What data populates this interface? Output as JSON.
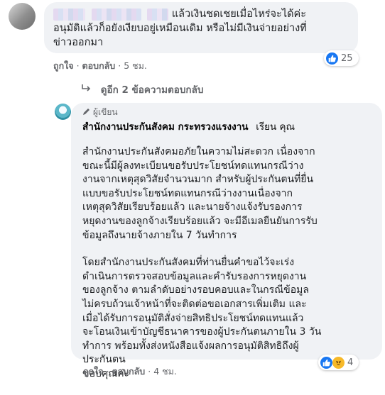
{
  "comment": {
    "text_line1_suffix": "แล้วเงินชดเชยเมื่อไหร่จะได้ค่ะ",
    "text_line2": "อนุมัติแล้วก็อยังเงียบอยู่เหมือนเดิม หรือไม่มีเงินจ่ายอย่างที่",
    "text_line3": "ข่าวออกมา",
    "like_label": "ถูกใจ",
    "reply_label": "ตอบกลับ",
    "time": "5 ชม.",
    "reaction_count": "25"
  },
  "more_replies": {
    "label": "ดูอีก 2 ข้อความตอบกลับ"
  },
  "reply": {
    "badge": "ผู้เขียน",
    "author": "สำนักงานประกันสังคม กระทรวงแรงงาน",
    "greeting": "เรียน คุณ",
    "para1": [
      "สำนักงานประกันสังคมอภัยในความไม่สะดวก เนื่องจาก",
      "ขณะนี้มีผู้ลงทะเบียนขอรับประโยชน์ทดแทนกรณีว่าง",
      "งานจากเหตุสุดวิสัยจำนวนมาก สำหรับผู้ประกันตนที่ยื่น",
      "แบบขอรับประโยชน์ทดแทนกรณีว่างงานเนื่องจาก",
      "เหตุสุดวิสัยเรียบร้อยแล้ว และนายจ้างแจ้งรับรองการ",
      "หยุดงานของลูกจ้างเรียบร้อยแล้ว จะมีอีเมลยืนยันการรับ",
      "ข้อมูลถึงนายจ้างภายใน 7 วันทำการ"
    ],
    "para2": [
      "โดยสำนักงานประกันสังคมที่ท่านยื่นคำขอไว้จะเร่ง",
      "ดำเนินการตรวจสอบข้อมูลและคำรับรองการหยุดงาน",
      "ของลูกจ้าง ตามลำดับอย่างรอบคอบและในกรณีข้อมูล",
      "ไม่ครบถ้วนเจ้าหน้าที่จะติดต่อขอเอกสารเพิ่มเติม และ",
      "เมื่อได้รับการอนุมัติสั่งจ่ายสิทธิประโยชน์ทดแทนแล้ว",
      "จะโอนเงินเข้าบัญชีธนาคารของผู้ประกันตนภายใน 3 วัน",
      "ทำการ พร้อมทั้งส่งหนังสือแจ้งผลการอนุมัติสิทธิถึงผู้",
      "ประกันตน",
      "ขอบคุณค่ะ"
    ],
    "like_label": "ถูกใจ",
    "reply_label": "ตอบกลับ",
    "time": "4 ชม.",
    "reaction_count": "4"
  },
  "colors": {
    "like": "#1877f2",
    "bubble": "#f0f2f5",
    "meta": "#65676b"
  }
}
